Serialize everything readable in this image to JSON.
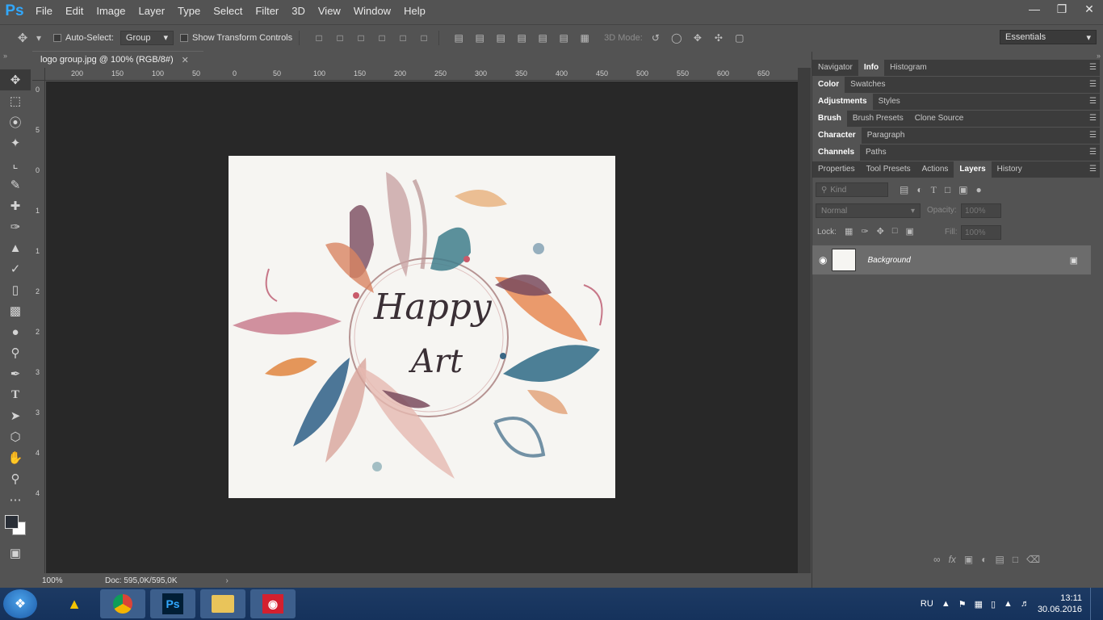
{
  "app": {
    "logo": "Ps",
    "menu": [
      "File",
      "Edit",
      "Image",
      "Layer",
      "Type",
      "Select",
      "Filter",
      "3D",
      "View",
      "Window",
      "Help"
    ]
  },
  "options": {
    "auto_select_label": "Auto-Select:",
    "auto_select_value": "Group",
    "transform_label": "Show Transform Controls",
    "mode_3d": "3D Mode:",
    "workspace": "Essentials"
  },
  "document": {
    "tab_title": "logo group.jpg @ 100% (RGB/8#)",
    "zoom": "100%",
    "doc_info": "Doc: 595,0K/595,0K"
  },
  "ruler": {
    "top_labels": [
      "200",
      "150",
      "100",
      "50",
      "0",
      "50",
      "100",
      "150",
      "200",
      "250",
      "300",
      "350",
      "400",
      "450",
      "500",
      "550",
      "600",
      "650"
    ],
    "left_labels": [
      "0",
      "5",
      "0",
      "1",
      "1",
      "2",
      "2",
      "3",
      "3",
      "4",
      "4"
    ]
  },
  "artwork": {
    "line1": "Happy",
    "line2": "Art"
  },
  "panels": {
    "row1": [
      "Navigator",
      "Info",
      "Histogram"
    ],
    "row2": [
      "Color",
      "Swatches"
    ],
    "row3": [
      "Adjustments",
      "Styles"
    ],
    "row4": [
      "Brush",
      "Brush Presets",
      "Clone Source"
    ],
    "row5": [
      "Character",
      "Paragraph"
    ],
    "row6": [
      "Channels",
      "Paths"
    ],
    "row7": [
      "Properties",
      "Tool Presets",
      "Actions",
      "Layers",
      "History"
    ]
  },
  "layers": {
    "filter_placeholder": "Kind",
    "blend_mode": "Normal",
    "opacity_label": "Opacity:",
    "opacity_value": "100%",
    "lock_label": "Lock:",
    "fill_label": "Fill:",
    "fill_value": "100%",
    "layer_name": "Background"
  },
  "taskbar": {
    "lang": "RU",
    "time": "13:11",
    "date": "30.06.2016"
  }
}
